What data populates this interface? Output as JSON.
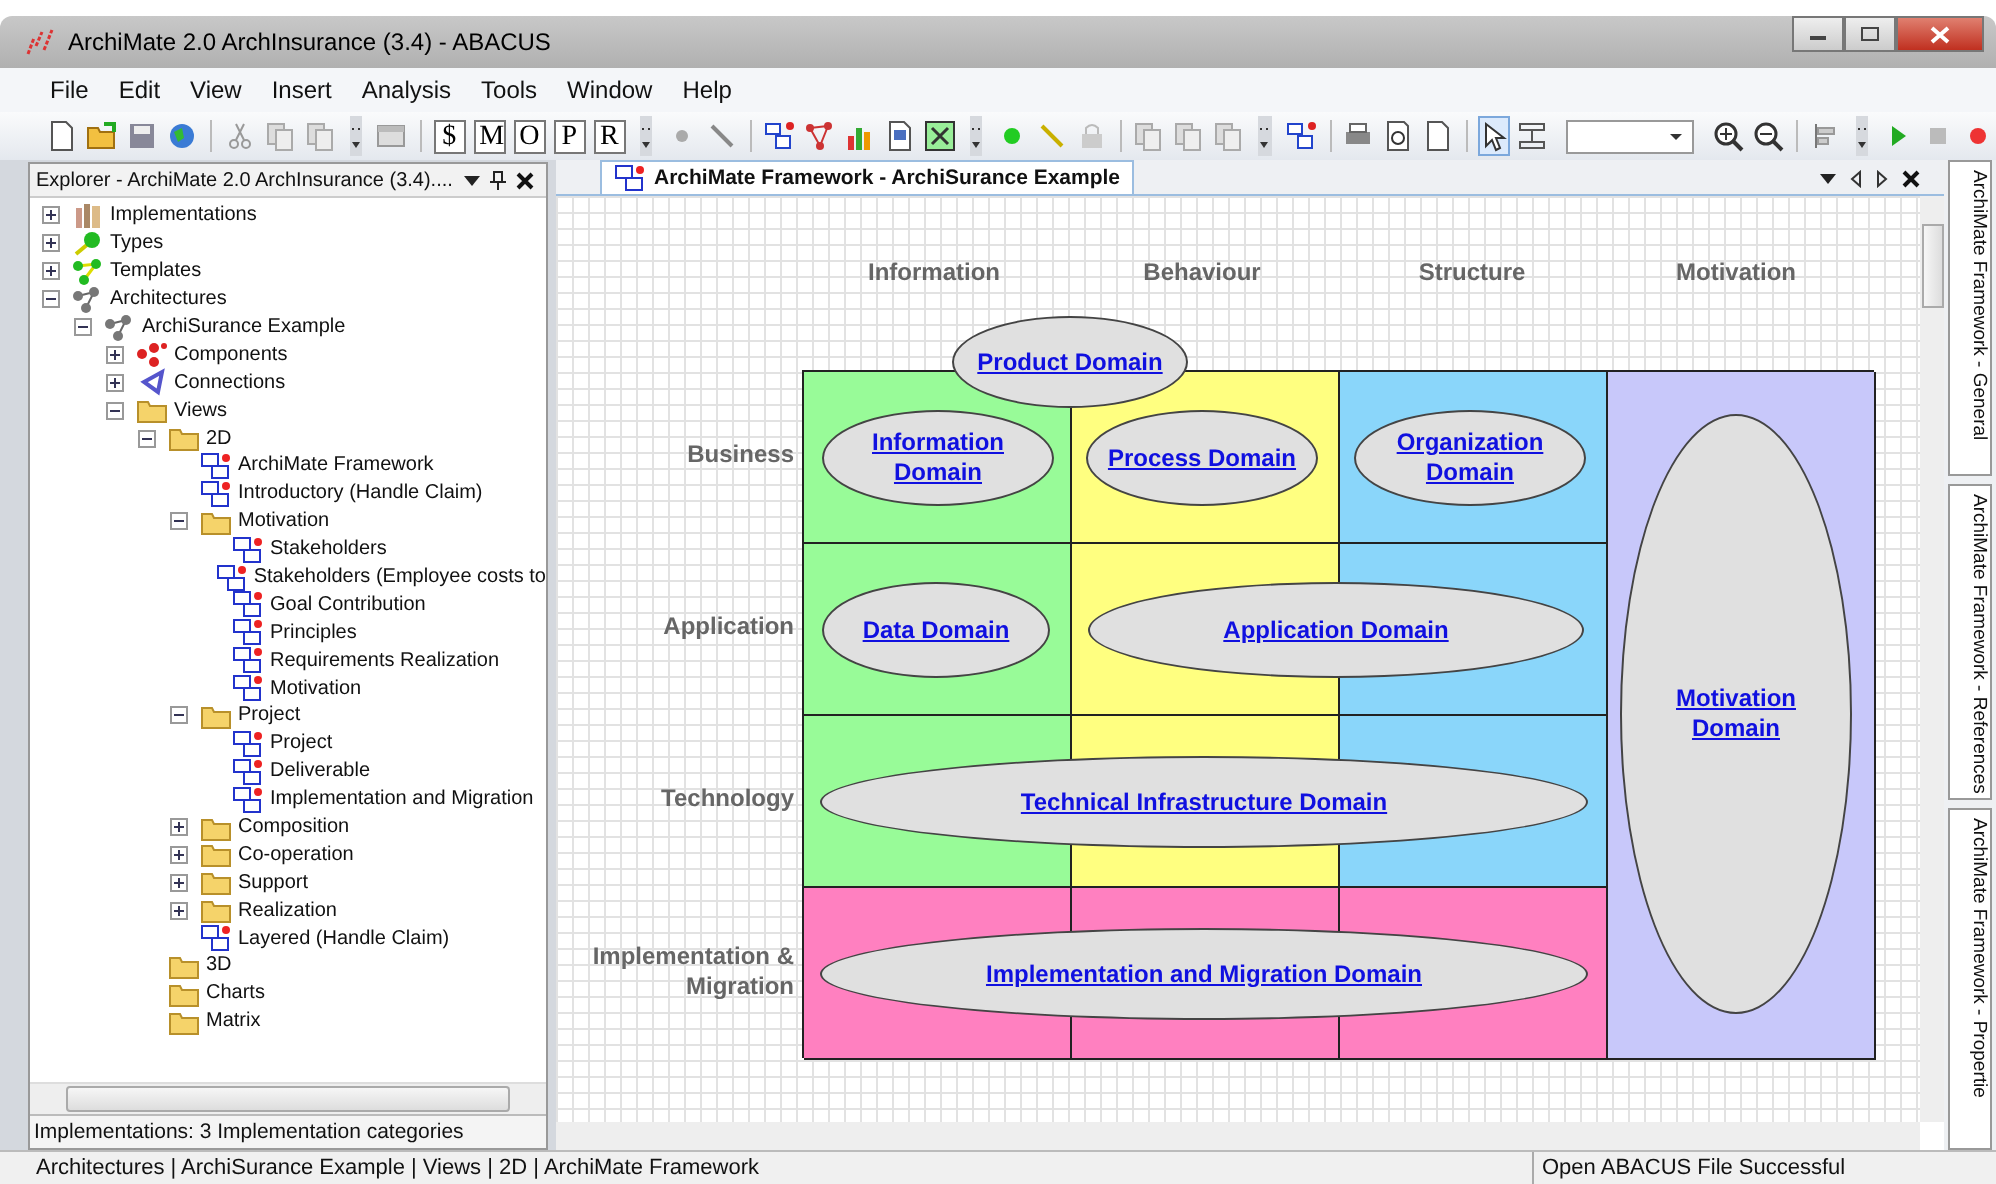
{
  "window": {
    "title": "ArchiMate 2.0 ArchInsurance (3.4) - ABACUS"
  },
  "menu": [
    "File",
    "Edit",
    "View",
    "Insert",
    "Analysis",
    "Tools",
    "Window",
    "Help"
  ],
  "toolbar": {
    "letter_buttons": [
      "$",
      "M",
      "O",
      "P",
      "R"
    ],
    "pointer_selected": true
  },
  "explorer": {
    "title": "Explorer - ArchiMate 2.0 ArchInsurance (3.4)....",
    "tree": [
      {
        "label": "Implementations",
        "kind": "implementations",
        "expanded": false
      },
      {
        "label": "Types",
        "kind": "types",
        "expanded": false
      },
      {
        "label": "Templates",
        "kind": "templates",
        "expanded": false
      },
      {
        "label": "Architectures",
        "kind": "architecture",
        "expanded": true,
        "children": [
          {
            "label": "ArchiSurance Example",
            "kind": "architecture",
            "expanded": true,
            "children": [
              {
                "label": "Components",
                "kind": "components",
                "expanded": false
              },
              {
                "label": "Connections",
                "kind": "connections",
                "expanded": false
              },
              {
                "label": "Views",
                "kind": "folder",
                "expanded": true,
                "children": [
                  {
                    "label": "2D",
                    "kind": "folder",
                    "expanded": true,
                    "children": [
                      {
                        "label": "ArchiMate Framework",
                        "kind": "view"
                      },
                      {
                        "label": "Introductory (Handle Claim)",
                        "kind": "view"
                      },
                      {
                        "label": "Motivation",
                        "kind": "folder",
                        "expanded": true,
                        "children": [
                          {
                            "label": "Stakeholders",
                            "kind": "view"
                          },
                          {
                            "label": "Stakeholders (Employee costs to",
                            "kind": "view"
                          },
                          {
                            "label": "Goal Contribution",
                            "kind": "view"
                          },
                          {
                            "label": "Principles",
                            "kind": "view"
                          },
                          {
                            "label": "Requirements Realization",
                            "kind": "view"
                          },
                          {
                            "label": "Motivation",
                            "kind": "view"
                          }
                        ]
                      },
                      {
                        "label": "Project",
                        "kind": "folder",
                        "expanded": true,
                        "children": [
                          {
                            "label": "Project",
                            "kind": "view"
                          },
                          {
                            "label": "Deliverable",
                            "kind": "view"
                          },
                          {
                            "label": "Implementation and Migration",
                            "kind": "view"
                          }
                        ]
                      },
                      {
                        "label": "Composition",
                        "kind": "folder",
                        "expanded": false
                      },
                      {
                        "label": "Co-operation",
                        "kind": "folder",
                        "expanded": false
                      },
                      {
                        "label": "Support",
                        "kind": "folder",
                        "expanded": false
                      },
                      {
                        "label": "Realization",
                        "kind": "folder",
                        "expanded": false
                      },
                      {
                        "label": "Layered (Handle Claim)",
                        "kind": "view"
                      }
                    ]
                  },
                  {
                    "label": "3D",
                    "kind": "folder"
                  },
                  {
                    "label": "Charts",
                    "kind": "folder"
                  },
                  {
                    "label": "Matrix",
                    "kind": "folder"
                  }
                ]
              }
            ]
          }
        ]
      }
    ],
    "status": "Implementations: 3 Implementation categories"
  },
  "document": {
    "tab": "ArchiMate Framework - ArchiSurance Example",
    "diagram": {
      "columns": [
        {
          "label": "Information",
          "color": "#98fb98"
        },
        {
          "label": "Behaviour",
          "color": "#ffff80"
        },
        {
          "label": "Structure",
          "color": "#8ad6fa"
        },
        {
          "label": "Motivation",
          "color": "#c8c8fa"
        }
      ],
      "rows": [
        {
          "label": "Business"
        },
        {
          "label": "Application"
        },
        {
          "label": "Technology"
        },
        {
          "label": "Implementation & Migration",
          "color": "#ff80c0"
        }
      ],
      "domains": [
        "Product Domain",
        "Information Domain",
        "Process Domain",
        "Organization Domain",
        "Data Domain",
        "Application Domain",
        "Technical Infrastructure Domain",
        "Implementation and Migration Domain",
        "Motivation Domain"
      ]
    }
  },
  "side_tabs": [
    "ArchiMate Framework - General",
    "ArchiMate Framework - References",
    "ArchiMate Framework - Propertie"
  ],
  "status_bar": {
    "path": "Architectures | ArchiSurance Example | Views | 2D | ArchiMate Framework",
    "message": "Open ABACUS File Successful"
  }
}
